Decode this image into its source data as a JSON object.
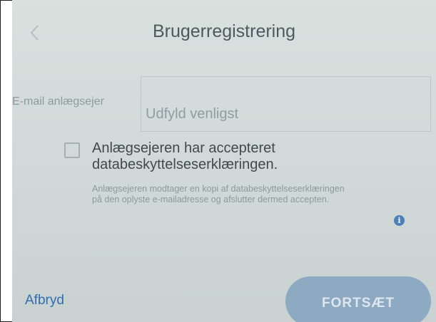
{
  "header": {
    "title": "Brugerregistrering",
    "back_icon": "chevron-left-icon"
  },
  "form": {
    "email_label": "E-mail anlægsejer",
    "email_placeholder": "Udfyld venligst",
    "email_value": ""
  },
  "consent": {
    "checked": false,
    "title": "Anlægsejeren har accepteret databeskyttelseserklæringen.",
    "note": "Anlægsejeren modtager en kopi af databeskyttelseserklæringen på den oplyste e-mailadresse og afslutter dermed accepten.",
    "info_icon": "info-icon",
    "info_glyph": "i"
  },
  "footer": {
    "cancel_label": "Afbryd",
    "continue_label": "FORTSÆT"
  },
  "colors": {
    "accent": "#2f6db0",
    "button_disabled": "#8ea9c2",
    "screen_background": "#d3dbda"
  }
}
